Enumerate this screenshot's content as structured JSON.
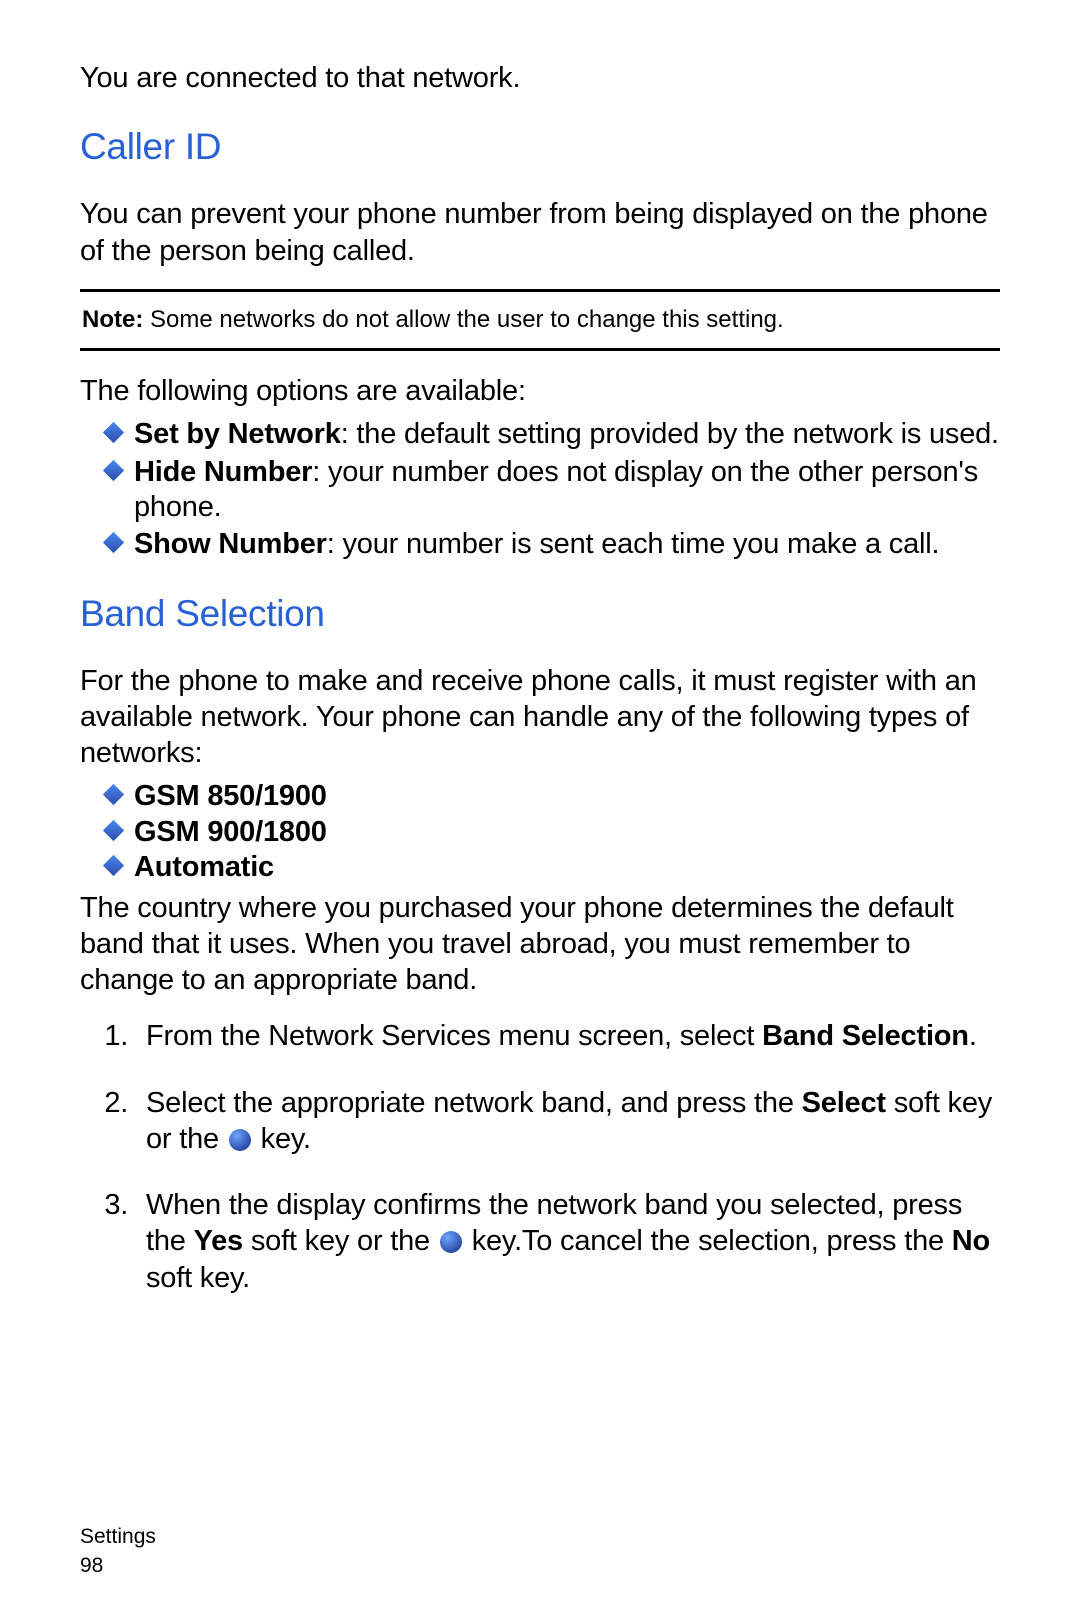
{
  "intro": "You are connected to that network.",
  "caller_id": {
    "heading": "Caller ID",
    "para": "You can prevent your phone number from being displayed on the phone of the person being called.",
    "note_label": "Note:",
    "note_text": " Some networks do not allow the user to change this setting.",
    "options_lead": "The following options are available:",
    "opts": [
      {
        "term": "Set by Network",
        "desc": ": the default setting provided by the network is used."
      },
      {
        "term": "Hide Number",
        "desc": ": your number does not display on the other person's phone."
      },
      {
        "term": "Show Number",
        "desc": ": your number is sent each time you make a call."
      }
    ]
  },
  "band": {
    "heading": "Band Selection",
    "para1": "For the phone to make and receive phone calls, it must register with an available network. Your phone can handle any of the following types of networks:",
    "types": [
      "GSM 850/1900",
      "GSM 900/1800",
      "Automatic"
    ],
    "para2": "The country where you purchased your phone determines the default band that it uses. When you travel abroad, you must remember to change to an appropriate band.",
    "steps": {
      "s1a": "From the Network Services menu screen, select ",
      "s1b": "Band Selection",
      "s1c": ".",
      "s2a": "Select the appropriate network band, and press the ",
      "s2b": "Select",
      "s2c": " soft key or the ",
      "s2d": " key.",
      "s3a": "When the display confirms the network band you selected, press the ",
      "s3b": "Yes",
      "s3c": " soft key or the ",
      "s3d": " key.To cancel the selection, press the ",
      "s3e": "No",
      "s3f": " soft key."
    }
  },
  "footer": {
    "section": "Settings",
    "page": "98"
  }
}
